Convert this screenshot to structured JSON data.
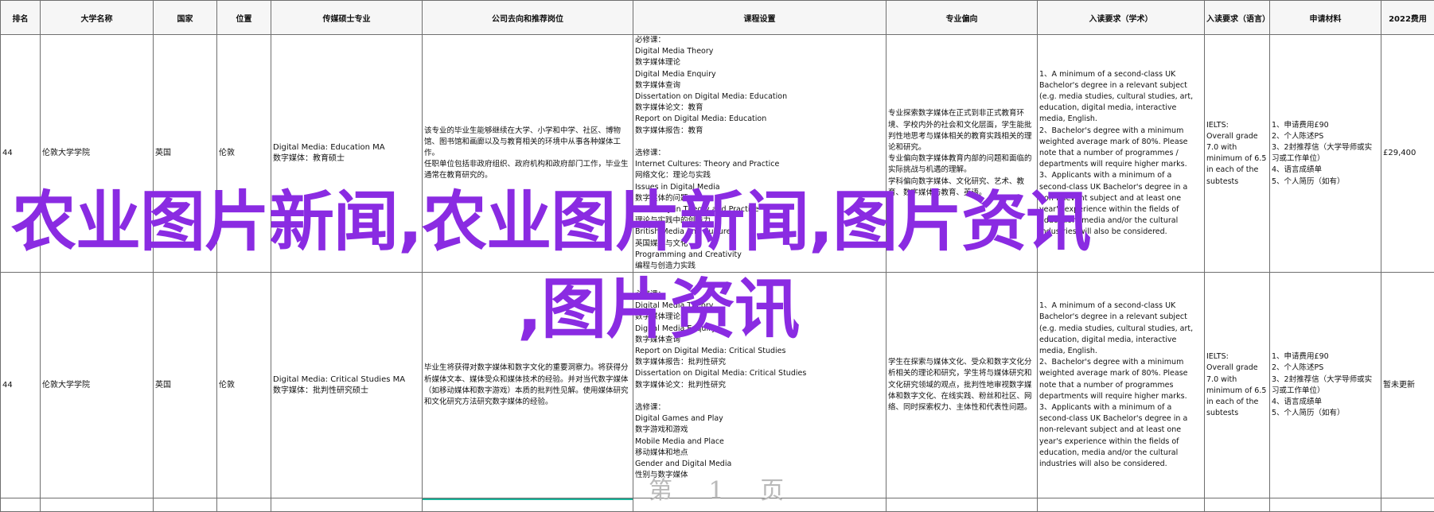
{
  "headers": [
    "排名",
    "大学名称",
    "国家",
    "位置",
    "传媒硕士专业",
    "公司去向和推荐岗位",
    "课程设置",
    "专业偏向",
    "入读要求（学术）",
    "入读要求（语言）",
    "申请材料",
    "2022费用"
  ],
  "rows": [
    {
      "rank": "44",
      "university": "伦敦大学学院",
      "country": "英国",
      "location": "伦敦",
      "major": "Digital Media: Education MA\n数字媒体：教育硕士",
      "career": "该专业的毕业生能够继续在大学、小学和中学、社区、博物馆、图书馆和画廊以及与教育相关的环境中从事各种媒体工作。\n任职单位包括非政府组织、政府机构和政府部门工作，毕业生通常在教育研究的。",
      "courses": "必修课：\nDigital Media Theory\n数字媒体理论\nDigital Media Enquiry\n数字媒体查询\nDissertation on Digital Media: Education\n数字媒体论文：教育\nReport on Digital Media: Education\n数字媒体报告：教育\n\n选修课：\nInternet Cultures: Theory and Practice\n网络文化：理论与实践\nIssues in Digital Media\n数字媒体的问题\nCreativity in Theory and Practice\n理论与实践中的创造力\nBritish Media and Culture\n英国媒体与文化\nProgramming and Creativity\n编程与创造力实践",
      "focus": "专业探索数字媒体在正式到非正式教育环境、学校内外的社会和文化层面，学生能批判性地思考与媒体相关的教育实践相关的理论和研究。\n专业偏向数字媒体教育内部的问题和面临的实际挑战与机遇的理解。\n学科偏向数字媒体、文化研究、艺术、教育、数字媒体与教育、英语。",
      "academic": "1、A minimum of a second-class UK Bachelor's degree in a relevant subject (e.g. media studies, cultural studies, art, education, digital media, interactive media, English.\n2、Bachelor's degree with a minimum weighted average mark of 80%. Please note that a number of programmes / departments will require higher marks.\n3、Applicants with a minimum of a second-class UK Bachelor's degree in a non-relevant subject and at least one year's experience within the fields of education, media and/or the cultural industries will also be considered.",
      "language": "IELTS:\nOverall grade 7.0 with minimum of 6.5 in each of the subtests",
      "materials": "1、申请费用£90\n2、个人陈述PS\n3、2封推荐信（大学导师或实习或工作单位）\n4、语言成绩单\n5、个人简历（如有）",
      "fee": "£29,400"
    },
    {
      "rank": "44",
      "university": "伦敦大学学院",
      "country": "英国",
      "location": "伦敦",
      "major": "Digital Media: Critical Studies MA\n数字媒体：批判性研究硕士",
      "career": "毕业生将获得对数字媒体和数字文化的重要洞察力。将获得分析媒体文本、媒体受众和媒体技术的经验。并对当代数字媒体（如移动媒体和数字游戏）本质的批判性见解。使用媒体研究和文化研究方法研究数字媒体的经验。",
      "courses": "必修课：\nDigital Media Theory\n数字媒体理论\nDigital Media Enquiry\n数字媒体查询\nReport on Digital Media: Critical Studies\n数字媒体报告：批判性研究\nDissertation on Digital Media: Critical Studies\n数字媒体论文：批判性研究\n\n选修课：\nDigital Games and Play\n数字游戏和游戏\nMobile Media and Place\n移动媒体和地点\nGender and Digital Media\n性别与数字媒体",
      "focus": "学生在探索与媒体文化、受众和数字文化分析相关的理论和研究，学生将与媒体研究和文化研究领域的观点，批判性地审视数字媒体和数字文化、在线实践、粉丝和社区、网络、同时探索权力、主体性和代表性问题。",
      "academic": "1、A minimum of a second-class UK Bachelor's degree in a relevant subject (e.g. media studies, cultural studies, art, education, digital media, interactive media, English.\n2、Bachelor's degree with a minimum weighted average mark of 80%. Please note that a number of programmes departments will require higher marks.\n3、Applicants with a minimum of a second-class UK Bachelor's degree in a non-relevant subject and at least one year's experience within the fields of education, media and/or the cultural industries will also be considered.",
      "language": "IELTS:\nOverall grade 7.0 with minimum of 6.5 in each of the subtests",
      "materials": "1、申请费用£90\n2、个人陈述PS\n3、2封推荐信（大学导师或实习或工作单位）\n4、语言成绩单\n5、个人简历（如有）",
      "fee": "暂未更新"
    }
  ],
  "watermark": {
    "line1": "农业图片新闻,农业图片新闻,图片资讯",
    "line2": ",图片资讯",
    "color": "#8a2be2"
  },
  "footer_ghost": "第 1 页"
}
